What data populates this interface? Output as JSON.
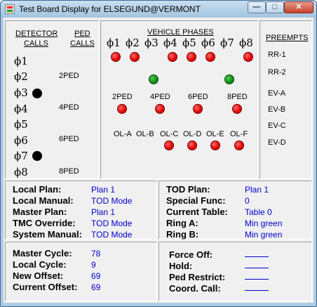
{
  "window": {
    "title": "Test Board Display for ELSEGUND@VERMONT"
  },
  "detector": {
    "header_line1": "DETECTOR",
    "header_line2": "CALLS",
    "items": [
      "ϕ1",
      "ϕ2",
      "ϕ3",
      "ϕ4",
      "ϕ5",
      "ϕ6",
      "ϕ7",
      "ϕ8"
    ],
    "active": [
      3,
      7
    ]
  },
  "ped_calls": {
    "header_line1": "PED",
    "header_line2": "CALLS",
    "items": [
      "2PED",
      "4PED",
      "6PED",
      "8PED"
    ]
  },
  "vehicle_phases": {
    "header": "VEHICLE PHASES",
    "phases": [
      "ϕ1",
      "ϕ2",
      "ϕ3",
      "ϕ4",
      "ϕ5",
      "ϕ6",
      "ϕ7",
      "ϕ8"
    ],
    "phase_led_colors": [
      "red",
      "red",
      "none",
      "red",
      "red",
      "red",
      "none",
      "red"
    ],
    "green_phases": [
      3,
      7
    ],
    "peds": [
      "2PED",
      "4PED",
      "6PED",
      "8PED"
    ],
    "overlaps": [
      "OL-A",
      "OL-B",
      "OL-C",
      "OL-D",
      "OL-E",
      "OL-F"
    ],
    "overlap_active": [
      "OL-C",
      "OL-D",
      "OL-E",
      "OL-F"
    ]
  },
  "preempts": {
    "header": "PREEMPTS",
    "items": [
      "RR-1",
      "RR-2",
      "EV-A",
      "EV-B",
      "EV-C",
      "EV-D"
    ]
  },
  "plan_info_left": [
    {
      "label": "Local Plan:",
      "value": "Plan 1"
    },
    {
      "label": "Local Manual:",
      "value": "TOD Mode"
    },
    {
      "label": "Master Plan:",
      "value": "Plan 1"
    },
    {
      "label": "TMC Override:",
      "value": "TOD Mode"
    },
    {
      "label": "System Manual:",
      "value": "TOD Mode"
    }
  ],
  "plan_info_right": [
    {
      "label": "TOD Plan:",
      "value": "Plan 1"
    },
    {
      "label": "Special Func:",
      "value": "0"
    },
    {
      "label": "Current Table:",
      "value": "Table 0"
    },
    {
      "label": "Ring A:",
      "value": "Min green"
    },
    {
      "label": "Ring B:",
      "value": "Min green"
    }
  ],
  "cycle_info": [
    {
      "label": "Master Cycle:",
      "value": "78"
    },
    {
      "label": "Local Cycle:",
      "value": "9"
    },
    {
      "label": "New Offset:",
      "value": "69"
    },
    {
      "label": "Current Offset:",
      "value": "69"
    }
  ],
  "force_info": [
    {
      "label": "Force Off:"
    },
    {
      "label": "Hold:"
    },
    {
      "label": "Ped Restrict:"
    },
    {
      "label": "Coord. Call:"
    }
  ],
  "colors": {
    "led_red": "#e00000",
    "led_green": "#118a11",
    "value_blue": "#0000cc"
  }
}
